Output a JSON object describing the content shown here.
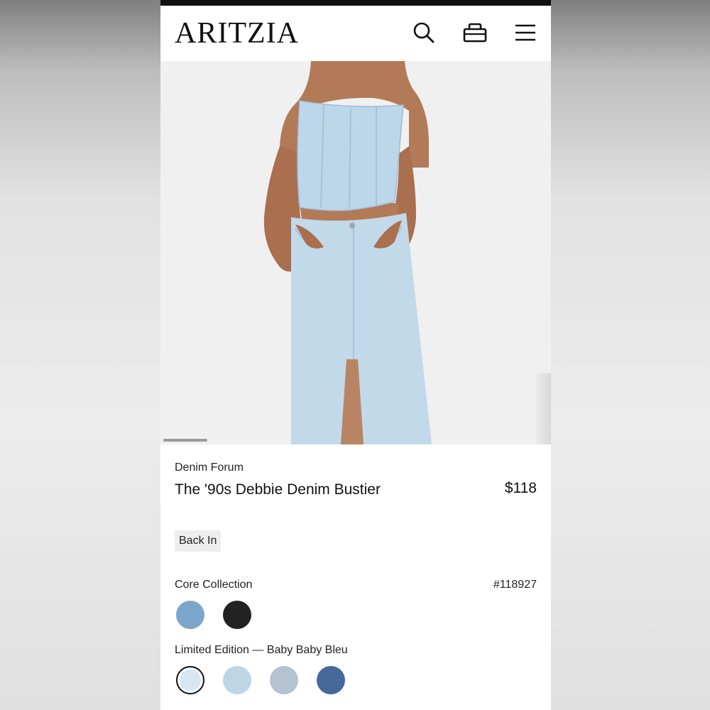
{
  "header": {
    "logo": "ARITZIA",
    "icons": [
      "search-icon",
      "bag-icon",
      "menu-icon"
    ]
  },
  "product": {
    "brand": "Denim Forum",
    "name": "The '90s Debbie Denim Bustier",
    "price": "$118",
    "badge": "Back In",
    "sku": "#118927"
  },
  "collections": {
    "core": {
      "label": "Core Collection",
      "swatches": [
        {
          "name": "medium-blue-denim",
          "color": "#7da6cc"
        },
        {
          "name": "black-denim",
          "color": "#222222"
        }
      ]
    },
    "limited": {
      "label": "Limited Edition — Baby Baby Bleu",
      "swatches": [
        {
          "name": "baby-bleu",
          "color": "#d6e6f3",
          "selected": true
        },
        {
          "name": "light-blue-denim",
          "color": "#bed5e6"
        },
        {
          "name": "light-grey-denim",
          "color": "#b4c3cf"
        },
        {
          "name": "dark-blue-denim",
          "color": "#46689a"
        }
      ]
    }
  },
  "colors": {
    "denim_light": "#bcd6ea",
    "skin": "#b27a57",
    "text": "#111111"
  }
}
